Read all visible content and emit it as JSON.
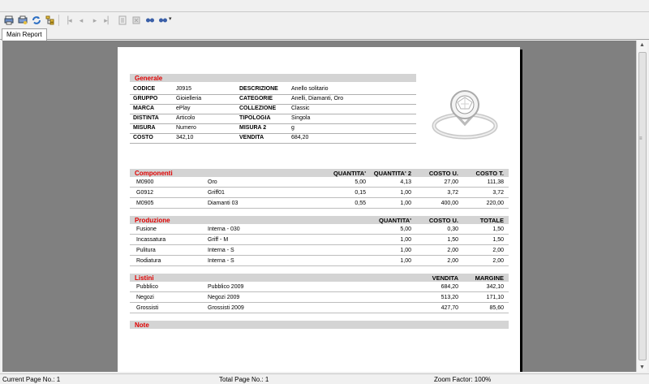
{
  "toolbar": {
    "buttons": [
      "print-icon",
      "print-setup-icon",
      "refresh-icon",
      "tree-icon",
      "first-page-icon",
      "prev-page-icon",
      "next-page-icon",
      "last-page-icon",
      "goto-page-icon",
      "stop-icon",
      "search-icon",
      "zoom-icon"
    ]
  },
  "tabs": [
    {
      "label": "Main Report"
    }
  ],
  "report": {
    "generale": {
      "title": "Generale",
      "fields": [
        {
          "k1": "CODICE",
          "v1": "J0915",
          "k2": "DESCRIZIONE",
          "v2": "Anello solitario"
        },
        {
          "k1": "GRUPPO",
          "v1": "Gioielleria",
          "k2": "CATEGORIE",
          "v2": "Anelli, Diamanti, Oro"
        },
        {
          "k1": "MARCA",
          "v1": "ePlay",
          "k2": "COLLEZIONE",
          "v2": "Classic"
        },
        {
          "k1": "DISTINTA",
          "v1": "Articolo",
          "k2": "TIPOLOGIA",
          "v2": "Singola"
        },
        {
          "k1": "MISURA",
          "v1": "Numero",
          "k2": "MISURA 2",
          "v2": "g"
        },
        {
          "k1": "COSTO",
          "v1": "342,10",
          "k2": "VENDITA",
          "v2": "684,20"
        }
      ]
    },
    "componenti": {
      "title": "Componenti",
      "headers": [
        "QUANTITA'",
        "QUANTITA' 2",
        "COSTO U.",
        "COSTO T."
      ],
      "rows": [
        {
          "code": "M0900",
          "name": "Oro",
          "q1": "5,00",
          "q2": "4,13",
          "cu": "27,00",
          "ct": "111,38"
        },
        {
          "code": "G0912",
          "name": "Griff01",
          "q1": "0,15",
          "q2": "1,00",
          "cu": "3,72",
          "ct": "3,72"
        },
        {
          "code": "M0905",
          "name": "Diamanti 03",
          "q1": "0,55",
          "q2": "1,00",
          "cu": "400,00",
          "ct": "220,00"
        }
      ]
    },
    "produzione": {
      "title": "Produzione",
      "headers": [
        "QUANTITA'",
        "COSTO U.",
        "TOTALE"
      ],
      "rows": [
        {
          "phase": "Fusione",
          "where": "Interna - 030",
          "q": "5,00",
          "cu": "0,30",
          "tot": "1,50"
        },
        {
          "phase": "Incassatura",
          "where": "Griff - M",
          "q": "1,00",
          "cu": "1,50",
          "tot": "1,50"
        },
        {
          "phase": "Pulitura",
          "where": "Interna - S",
          "q": "1,00",
          "cu": "2,00",
          "tot": "2,00"
        },
        {
          "phase": "Rodiatura",
          "where": "Interna - S",
          "q": "1,00",
          "cu": "2,00",
          "tot": "2,00"
        }
      ]
    },
    "listini": {
      "title": "Listini",
      "headers": [
        "VENDITA",
        "MARGINE"
      ],
      "rows": [
        {
          "name": "Pubblico",
          "list": "Pubblico 2009",
          "vendita": "684,20",
          "margine": "342,10"
        },
        {
          "name": "Negozi",
          "list": "Negozi 2009",
          "vendita": "513,20",
          "margine": "171,10"
        },
        {
          "name": "Grossisti",
          "list": "Grossisti 2009",
          "vendita": "427,70",
          "margine": "85,60"
        }
      ]
    },
    "note": {
      "title": "Note"
    }
  },
  "status": {
    "current_page": "Current Page No.: 1",
    "total_page": "Total Page No.: 1",
    "zoom": "Zoom Factor: 100%"
  }
}
